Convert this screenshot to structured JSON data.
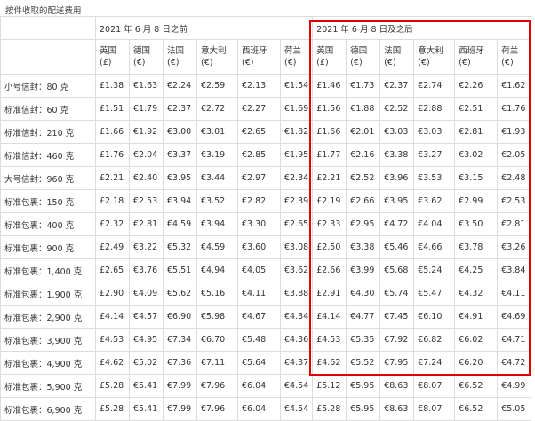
{
  "caption": "按件收取的配送费用",
  "groups": [
    "2021 年 6 月 8 日之前",
    "2021 年 6 月 8 日及之后"
  ],
  "columns": [
    {
      "country": "英国",
      "currency": "(£)"
    },
    {
      "country": "德国",
      "currency": "(€)"
    },
    {
      "country": "法国",
      "currency": "(€)"
    },
    {
      "country": "意大利",
      "currency": "(€)"
    },
    {
      "country": "西班牙",
      "currency": "(€)"
    },
    {
      "country": "荷兰",
      "currency": "(€)"
    }
  ],
  "rows": [
    {
      "label": "小号信封：80 克",
      "before": [
        "£1.38",
        "€1.63",
        "€2.24",
        "€2.59",
        "€2.13",
        "€1.54"
      ],
      "after": [
        "£1.46",
        "€1.73",
        "€2.37",
        "€2.74",
        "€2.26",
        "€1.62"
      ]
    },
    {
      "label": "标准信封：60 克",
      "before": [
        "£1.51",
        "€1.79",
        "€2.37",
        "€2.72",
        "€2.27",
        "€1.69"
      ],
      "after": [
        "£1.56",
        "€1.88",
        "€2.52",
        "€2.88",
        "€2.51",
        "€1.76"
      ]
    },
    {
      "label": "标准信封：210 克",
      "before": [
        "£1.66",
        "€1.92",
        "€3.00",
        "€3.01",
        "€2.65",
        "€1.82"
      ],
      "after": [
        "£1.66",
        "€2.01",
        "€3.03",
        "€3.03",
        "€2.81",
        "€1.93"
      ]
    },
    {
      "label": "标准信封：460 克",
      "before": [
        "£1.76",
        "€2.04",
        "€3.37",
        "€3.19",
        "€2.85",
        "€1.95"
      ],
      "after": [
        "£1.77",
        "€2.16",
        "€3.38",
        "€3.27",
        "€3.02",
        "€2.05"
      ]
    },
    {
      "label": "大号信封：960 克",
      "before": [
        "£2.21",
        "€2.40",
        "€3.95",
        "€3.44",
        "€2.97",
        "€2.34"
      ],
      "after": [
        "£2.21",
        "€2.52",
        "€3.96",
        "€3.53",
        "€3.15",
        "€2.48"
      ]
    },
    {
      "label": "标准包裹：150 克",
      "before": [
        "£2.18",
        "€2.53",
        "€3.94",
        "€3.52",
        "€2.82",
        "€2.39"
      ],
      "after": [
        "£2.19",
        "€2.66",
        "€3.95",
        "€3.62",
        "€2.99",
        "€2.53"
      ]
    },
    {
      "label": "标准包裹：400 克",
      "before": [
        "£2.32",
        "€2.81",
        "€4.59",
        "€3.94",
        "€3.30",
        "€2.65"
      ],
      "after": [
        "£2.33",
        "€2.95",
        "€4.72",
        "€4.04",
        "€3.50",
        "€2.81"
      ]
    },
    {
      "label": "标准包裹：900 克",
      "before": [
        "£2.49",
        "€3.22",
        "€5.32",
        "€4.59",
        "€3.60",
        "€3.08"
      ],
      "after": [
        "£2.50",
        "€3.38",
        "€5.46",
        "€4.66",
        "€3.78",
        "€3.26"
      ]
    },
    {
      "label": "标准包裹：1,400 克",
      "before": [
        "£2.65",
        "€3.76",
        "€5.51",
        "€4.94",
        "€4.05",
        "€3.62"
      ],
      "after": [
        "£2.66",
        "€3.99",
        "€5.68",
        "€5.24",
        "€4.25",
        "€3.84"
      ]
    },
    {
      "label": "标准包裹：1,900 克",
      "before": [
        "£2.90",
        "€4.09",
        "€5.62",
        "€5.16",
        "€4.11",
        "€3.88"
      ],
      "after": [
        "£2.91",
        "€4.30",
        "€5.74",
        "€5.47",
        "€4.32",
        "€4.11"
      ]
    },
    {
      "label": "标准包裹：2,900 克",
      "before": [
        "£4.14",
        "€4.57",
        "€6.90",
        "€5.98",
        "€4.67",
        "€4.34"
      ],
      "after": [
        "£4.14",
        "€4.77",
        "€7.45",
        "€6.10",
        "€4.91",
        "€4.69"
      ]
    },
    {
      "label": "标准包裹：3,900 克",
      "before": [
        "£4.53",
        "€4.95",
        "€7.34",
        "€6.70",
        "€5.48",
        "€4.36"
      ],
      "after": [
        "£4.53",
        "€5.35",
        "€7.92",
        "€6.82",
        "€6.02",
        "€4.71"
      ]
    },
    {
      "label": "标准包裹：4,900 克",
      "before": [
        "£4.62",
        "€5.02",
        "€7.36",
        "€7.11",
        "€5.64",
        "€4.37"
      ],
      "after": [
        "£4.62",
        "€5.52",
        "€7.95",
        "€7.24",
        "€6.20",
        "€4.72"
      ]
    },
    {
      "label": "标准包裹：5,900 克",
      "before": [
        "£5.28",
        "€5.41",
        "€7.99",
        "€7.96",
        "€6.04",
        "€4.54"
      ],
      "after": [
        "£5.12",
        "€5.95",
        "€8.63",
        "€8.07",
        "€6.52",
        "€4.99"
      ]
    },
    {
      "label": "标准包裹：6,900 克",
      "before": [
        "£5.28",
        "€5.41",
        "€7.99",
        "€7.96",
        "€6.04",
        "€4.54"
      ],
      "after": [
        "£5.28",
        "€5.95",
        "€8.63",
        "€8.07",
        "€6.52",
        "€5.05"
      ]
    }
  ],
  "colors": {
    "highlight": "#e00000",
    "grid": "#dcdcdc"
  }
}
